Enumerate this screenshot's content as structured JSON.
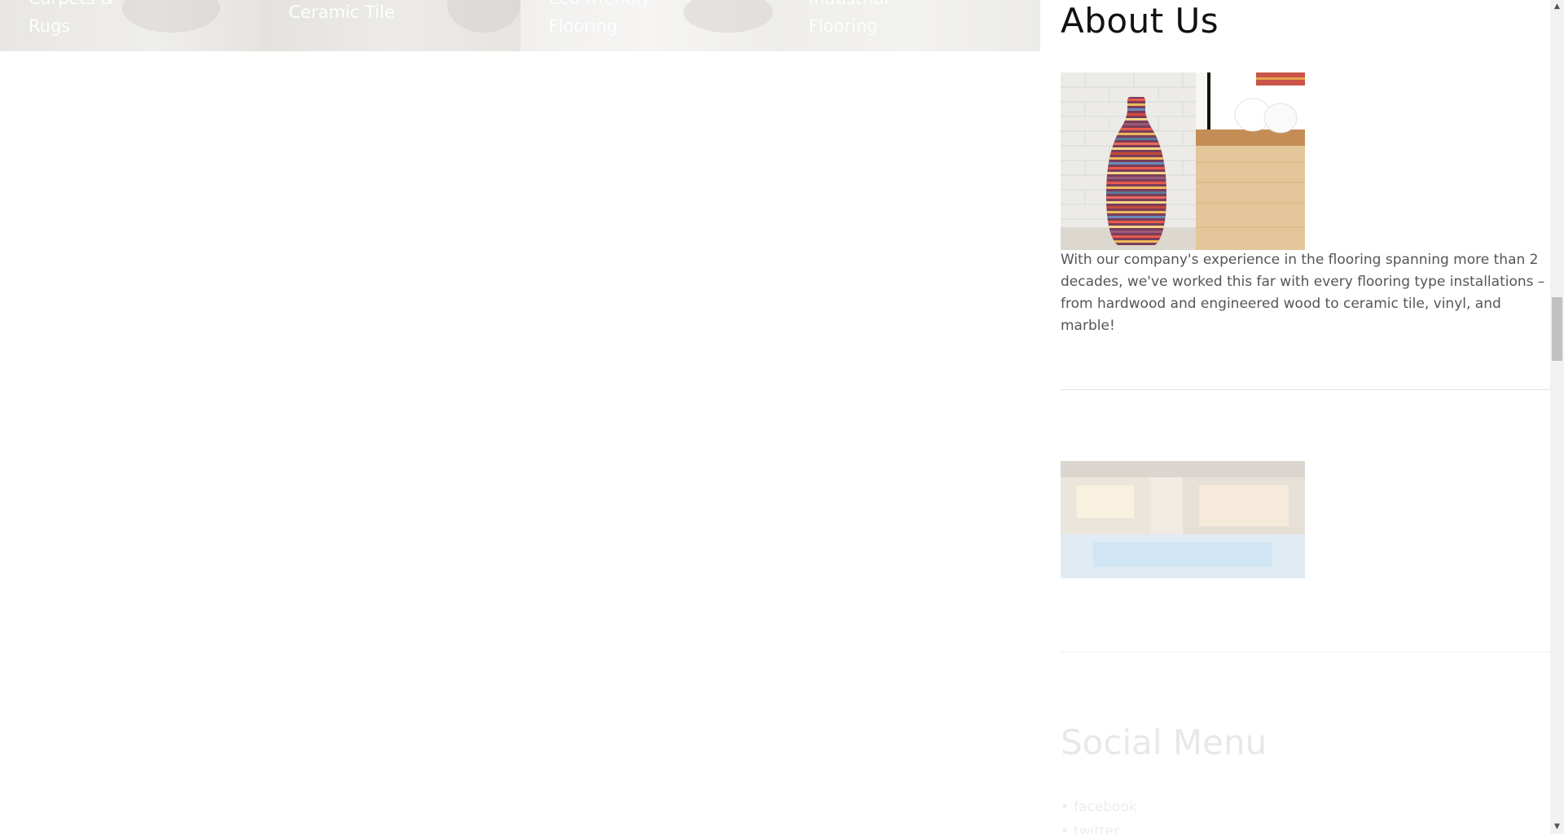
{
  "categories": [
    {
      "label": "Carpets & Rugs"
    },
    {
      "label": "Ceramic Tile"
    },
    {
      "label": "Eco-friendly Flooring"
    },
    {
      "label": "Industrial Flooring"
    }
  ],
  "about": {
    "title": "About Us",
    "text": "With our company's experience in the flooring spanning more than 2 decades, we've worked this far with every flooring type installations – from hardwood and engineered wood to ceramic tile, vinyl, and marble!"
  },
  "social": {
    "title": "Social Menu",
    "items": [
      {
        "label": "facebook"
      },
      {
        "label": "twitter"
      }
    ]
  },
  "colors": {
    "heading": "#111111",
    "body_text": "#555555",
    "divider": "#e2e2e2",
    "scroll_thumb": "#c1c1c1"
  },
  "icons": {
    "scroll_up": "triangle-up-icon",
    "scroll_down": "triangle-down-icon"
  }
}
